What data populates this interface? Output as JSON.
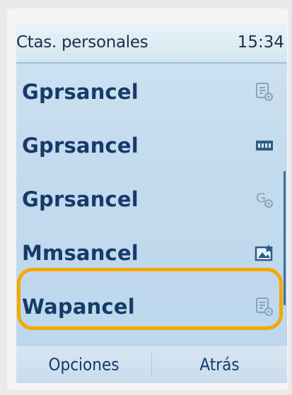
{
  "status_bar": {
    "title": "Ctas. personales",
    "time": "15:34"
  },
  "accounts": [
    {
      "label": "Gprsancel",
      "icon": "document-settings-icon"
    },
    {
      "label": "Gprsancel",
      "icon": "film-strip-icon"
    },
    {
      "label": "Gprsancel",
      "icon": "gprs-settings-icon"
    },
    {
      "label": "Mmsancel",
      "icon": "mms-picture-icon"
    },
    {
      "label": "Wapancel",
      "icon": "document-settings-icon"
    }
  ],
  "selected_index": 4,
  "softkeys": {
    "left": "Opciones",
    "right": "Atrás"
  },
  "colors": {
    "highlight": "#f5a800",
    "text": "#163a6a",
    "screen_bg": "#c3dbee"
  }
}
